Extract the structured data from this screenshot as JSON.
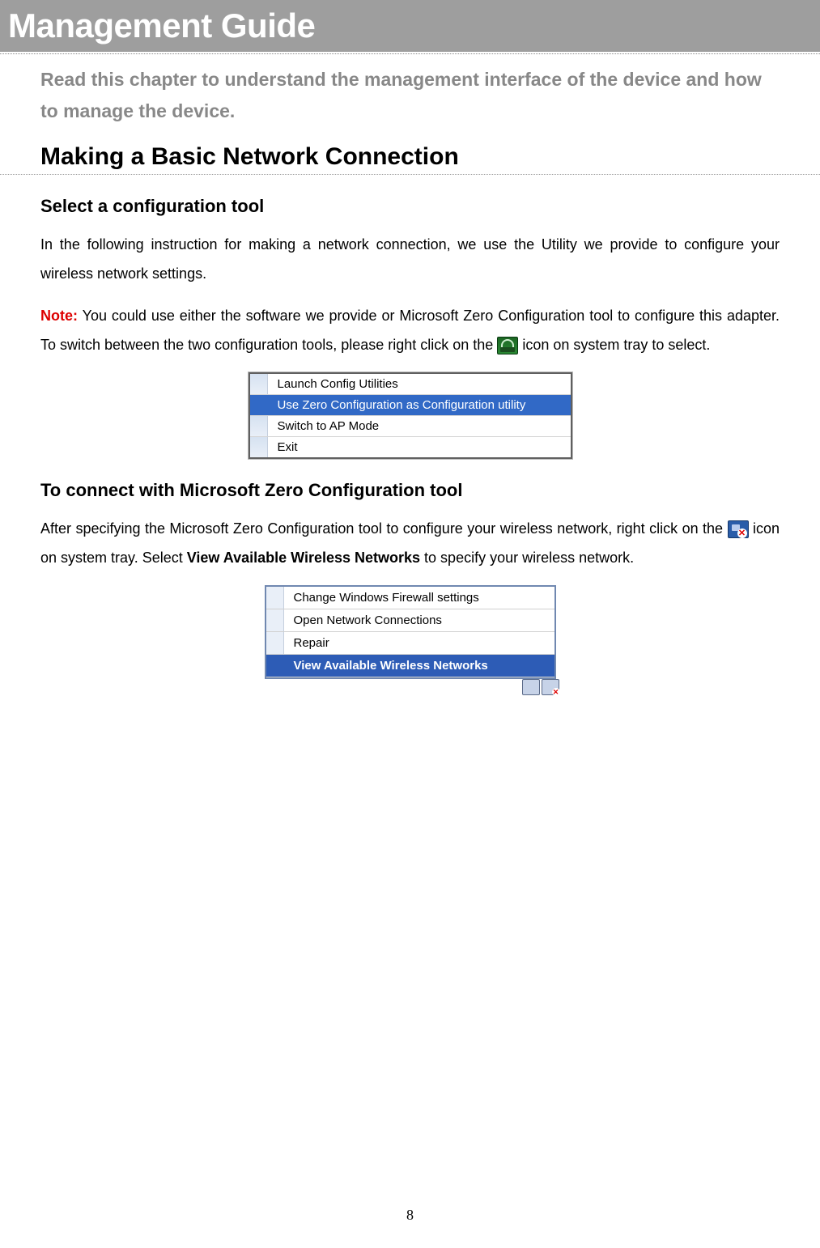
{
  "header": {
    "title": "Management Guide"
  },
  "chapter_description": "Read this chapter to understand the management interface of the device and how to manage the device.",
  "section1": {
    "title": "Making a Basic Network Connection"
  },
  "subsection1": {
    "title": "Select a configuration tool",
    "para1": "In the following instruction for making a network connection, we use the Utility we provide to configure your wireless network settings.",
    "note_label": "Note:",
    "note_text_before_icon": " You could use either the software we provide or Microsoft Zero Configuration tool to configure this adapter. To switch between the two configuration tools, please right click on the ",
    "note_text_after_icon": " icon on system tray to select."
  },
  "menu1": {
    "items": [
      {
        "label": "Launch Config Utilities",
        "selected": false
      },
      {
        "label": "Use Zero Configuration as Configuration utility",
        "selected": true
      },
      {
        "label": "Switch to AP Mode",
        "selected": false
      },
      {
        "label": "Exit",
        "selected": false
      }
    ]
  },
  "subsection2": {
    "title": "To connect with Microsoft Zero Configuration tool",
    "para_before_icon": "After specifying the Microsoft Zero Configuration tool to configure your wireless network, right click on the ",
    "para_after_icon_pre_bold": " icon on system tray. Select ",
    "bold_phrase": "View Available Wireless Networks",
    "para_after_bold": " to specify your wireless network."
  },
  "menu2": {
    "items": [
      {
        "label": "Change Windows Firewall settings",
        "selected": false,
        "bold": false
      },
      {
        "label": "Open Network Connections",
        "selected": false,
        "bold": false
      },
      {
        "label": "Repair",
        "selected": false,
        "bold": false
      },
      {
        "label": "View Available Wireless Networks",
        "selected": true,
        "bold": true
      }
    ]
  },
  "page_number": "8"
}
